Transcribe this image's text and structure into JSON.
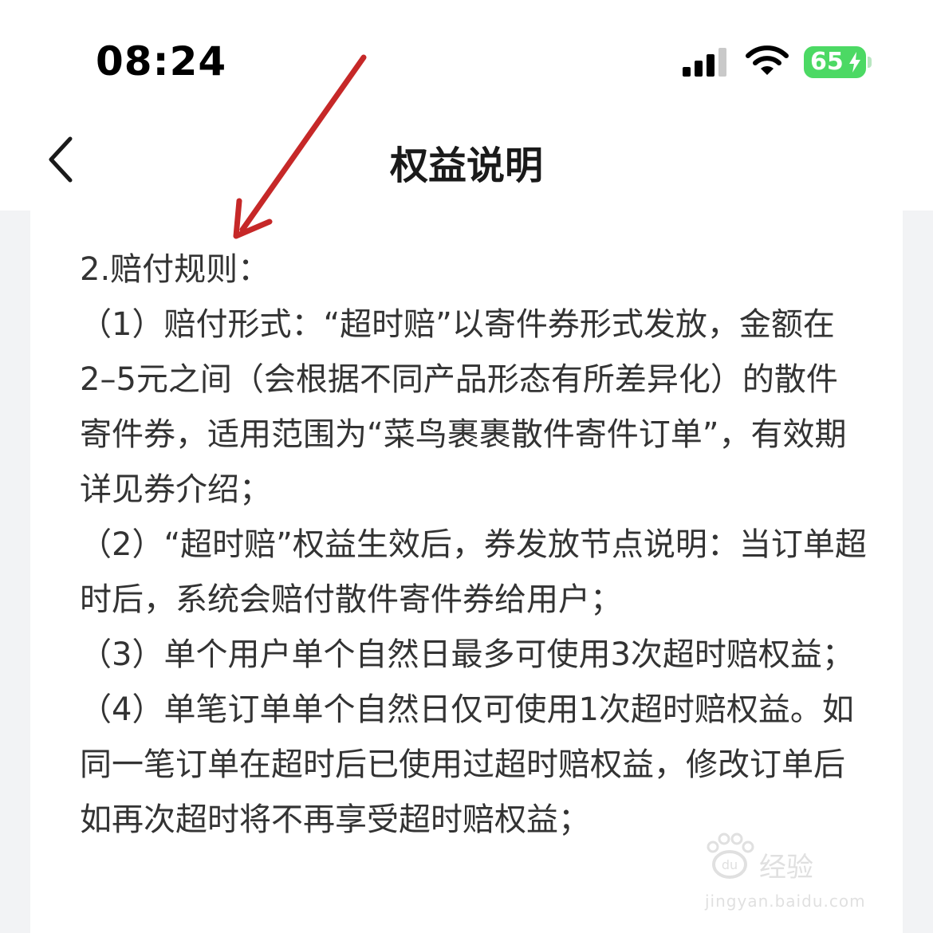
{
  "status_bar": {
    "time": "08:24",
    "battery_level": "65",
    "battery_color": "#4cd964"
  },
  "nav": {
    "title": "权益说明",
    "back_icon": "chevron-left-icon"
  },
  "content": {
    "paragraphs": [
      "2.赔付规则：",
      "（1）赔付形式：“超时赔”以寄件券形式发放，金额在2–5元之间（会根据不同产品形态有所差异化）的散件寄件券，适用范围为“菜鸟裹裹散件寄件订单”，有效期详见券介绍；",
      "（2）“超时赔”权益生效后，券发放节点说明：当订单超时后，系统会赔付散件寄件券给用户；",
      "（3）单个用户单个自然日最多可使用3次超时赔权益；",
      "（4）单笔订单单个自然日仅可使用1次超时赔权益。如同一笔订单在超时后已使用过超时赔权益，修改订单后如再次超时将不再享受超时赔权益；"
    ]
  },
  "annotation": {
    "arrow_color": "#c62828"
  },
  "watermark": {
    "brand": "经验",
    "domain": "jingyan.baidu.com"
  }
}
